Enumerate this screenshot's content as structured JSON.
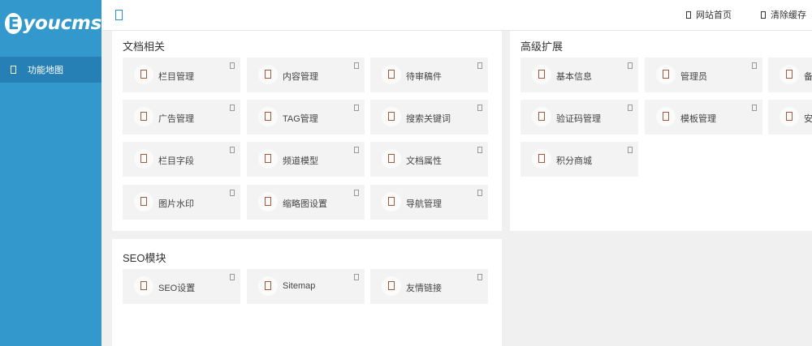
{
  "brand": {
    "mark": "E",
    "name": "youcms"
  },
  "sidebar": {
    "items": [
      {
        "label": "功能地图",
        "active": true
      }
    ]
  },
  "topbar": {
    "links": [
      "网站首页",
      "清除缓存"
    ]
  },
  "colors": {
    "sidebar": "#3399cc",
    "sidebar_active": "#2680b6",
    "tile_bg": "#f3f3f3",
    "tile_icon": "#a35a3a"
  },
  "sections": [
    {
      "title": "文档相关",
      "items": [
        "栏目管理",
        "内容管理",
        "待审稿件",
        "广告管理",
        "TAG管理",
        "搜索关键词",
        "栏目字段",
        "频道模型",
        "文档属性",
        "图片水印",
        "缩略图设置",
        "导航管理"
      ]
    },
    {
      "title": "高级扩展",
      "items": [
        "基本信息",
        "管理员",
        "备",
        "验证码管理",
        "模板管理",
        "安",
        "积分商城"
      ]
    },
    {
      "title": "SEO模块",
      "items": [
        "SEO设置",
        "Sitemap",
        "友情链接"
      ]
    }
  ]
}
